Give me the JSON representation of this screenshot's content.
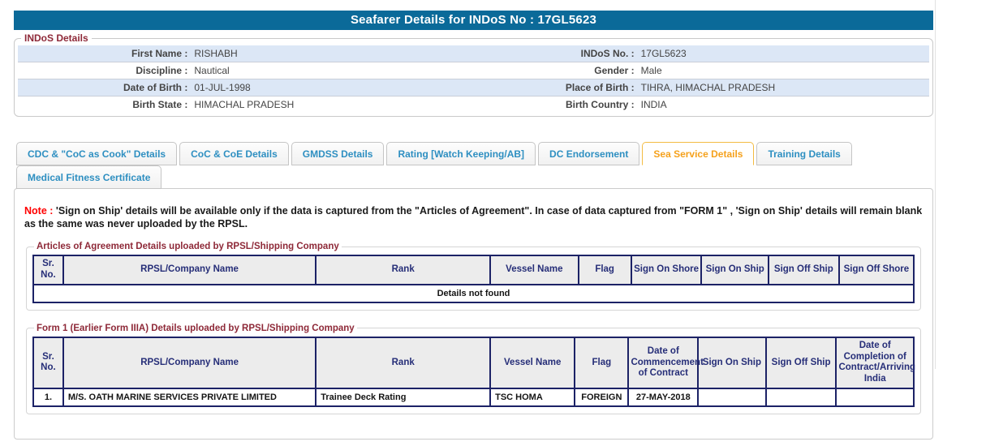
{
  "header": {
    "title": "Seafarer Details for INDoS No : 17GL5623"
  },
  "indos": {
    "legend": "INDoS Details",
    "rows": [
      {
        "l1": "First Name :",
        "v1": "RISHABH",
        "l2": "INDoS No. :",
        "v2": "17GL5623"
      },
      {
        "l1": "Discipline :",
        "v1": "Nautical",
        "l2": "Gender :",
        "v2": "Male"
      },
      {
        "l1": "Date of Birth :",
        "v1": "01-JUL-1998",
        "l2": "Place of Birth :",
        "v2": "TIHRA, HIMACHAL PRADESH"
      },
      {
        "l1": "Birth State :",
        "v1": "HIMACHAL PRADESH",
        "l2": "Birth Country :",
        "v2": "INDIA"
      }
    ]
  },
  "tabs": [
    {
      "label": "CDC & \"CoC as Cook\" Details",
      "active": false
    },
    {
      "label": "CoC & CoE Details",
      "active": false
    },
    {
      "label": "GMDSS Details",
      "active": false
    },
    {
      "label": "Rating [Watch Keeping/AB]",
      "active": false
    },
    {
      "label": "DC Endorsement",
      "active": false
    },
    {
      "label": "Sea Service Details",
      "active": true
    },
    {
      "label": "Training Details",
      "active": false
    },
    {
      "label": "Medical Fitness Certificate",
      "active": false
    }
  ],
  "note": {
    "label": "Note :",
    "text": " 'Sign on Ship' details will be available only if the data is captured from the \"Articles of Agreement\". In case of data captured from \"FORM 1\" , 'Sign on Ship' details will remain blank as the same was never uploaded by the RPSL."
  },
  "tables": {
    "agreement": {
      "legend": "Articles of Agreement Details uploaded by RPSL/Shipping Company",
      "headers": [
        "Sr. No.",
        "RPSL/Company Name",
        "Rank",
        "Vessel Name",
        "Flag",
        "Sign On Shore",
        "Sign On Ship",
        "Sign Off Ship",
        "Sign Off Shore"
      ],
      "empty_text": "Details not found"
    },
    "form1": {
      "legend": "Form 1 (Earlier Form IIIA) Details uploaded by RPSL/Shipping Company",
      "headers": [
        "Sr. No.",
        "RPSL/Company Name",
        "Rank",
        "Vessel Name",
        "Flag",
        "Date of Commencement of Contract",
        "Sign On Ship",
        "Sign Off Ship",
        "Date of Completion of Contract/Arriving India"
      ],
      "rows": [
        {
          "sr": "1.",
          "company": "M/S. OATH MARINE SERVICES PRIVATE LIMITED",
          "rank": "Trainee Deck Rating",
          "vessel": "TSC HOMA",
          "flag": "FOREIGN",
          "date_commencement": "27-MAY-2018",
          "sign_on_ship": "",
          "sign_off_ship": "",
          "date_completion": ""
        }
      ]
    }
  },
  "colors": {
    "title_bar": "#0b6a99",
    "legend_maroon": "#8e2938",
    "row_alt_blue": "#dce7f6",
    "tab_inactive_text": "#2e8fc1",
    "tab_active_text": "#f5a11c",
    "tab_active_border": "#f3bb42",
    "table_border_navy": "#1c2266",
    "table_header_text": "#262e78",
    "error_red": "#cc0000",
    "note_red": "#ff0000"
  }
}
